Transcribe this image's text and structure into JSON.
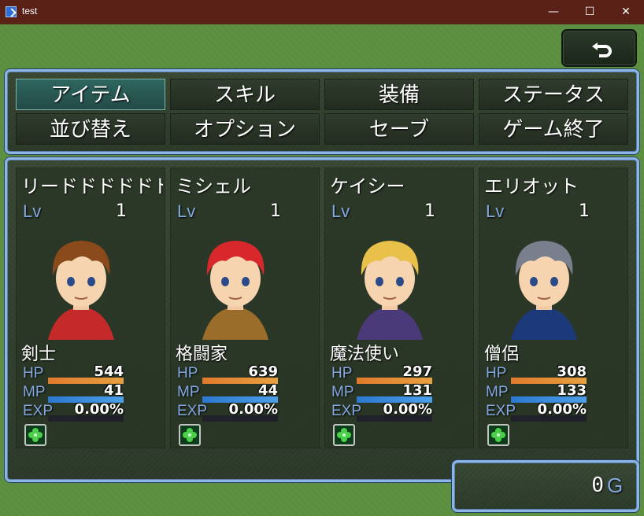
{
  "window": {
    "title": "test",
    "minimize_glyph": "—",
    "maximize_glyph": "☐",
    "close_glyph": "✕"
  },
  "menu": {
    "commands": [
      {
        "label": "アイテム",
        "selected": true
      },
      {
        "label": "スキル"
      },
      {
        "label": "装備"
      },
      {
        "label": "ステータス"
      },
      {
        "label": "並び替え"
      },
      {
        "label": "オプション"
      },
      {
        "label": "セーブ"
      },
      {
        "label": "ゲーム終了"
      }
    ]
  },
  "party": {
    "lv_label": "Lv",
    "hp_label": "HP",
    "mp_label": "MP",
    "exp_label": "EXP",
    "members": [
      {
        "name": "リードドドドドドドドド",
        "level": "1",
        "class": "剣士",
        "hp": "544",
        "hp_rate": 1.0,
        "mp": "41",
        "mp_rate": 1.0,
        "exp": "0.00%",
        "hair": "#8a4a1c",
        "outfit": "#c42a2a"
      },
      {
        "name": "ミシェル",
        "level": "1",
        "class": "格闘家",
        "hp": "639",
        "hp_rate": 1.0,
        "mp": "44",
        "mp_rate": 1.0,
        "exp": "0.00%",
        "hair": "#d9282c",
        "outfit": "#9a6d2a"
      },
      {
        "name": "ケイシー",
        "level": "1",
        "class": "魔法使い",
        "hp": "297",
        "hp_rate": 1.0,
        "mp": "131",
        "mp_rate": 1.0,
        "exp": "0.00%",
        "hair": "#e8c04a",
        "outfit": "#4a3a7a"
      },
      {
        "name": "エリオット",
        "level": "1",
        "class": "僧侶",
        "hp": "308",
        "hp_rate": 1.0,
        "mp": "133",
        "mp_rate": 1.0,
        "exp": "0.00%",
        "hair": "#7a7f8e",
        "outfit": "#1c3a7a"
      }
    ]
  },
  "gold": {
    "value": "0",
    "unit": "G"
  },
  "colors": {
    "hp_gauge": "#e8a040",
    "mp_gauge": "#4aa0e8",
    "system_text": "#84a8e0",
    "window_border": "#8ab6e8"
  }
}
